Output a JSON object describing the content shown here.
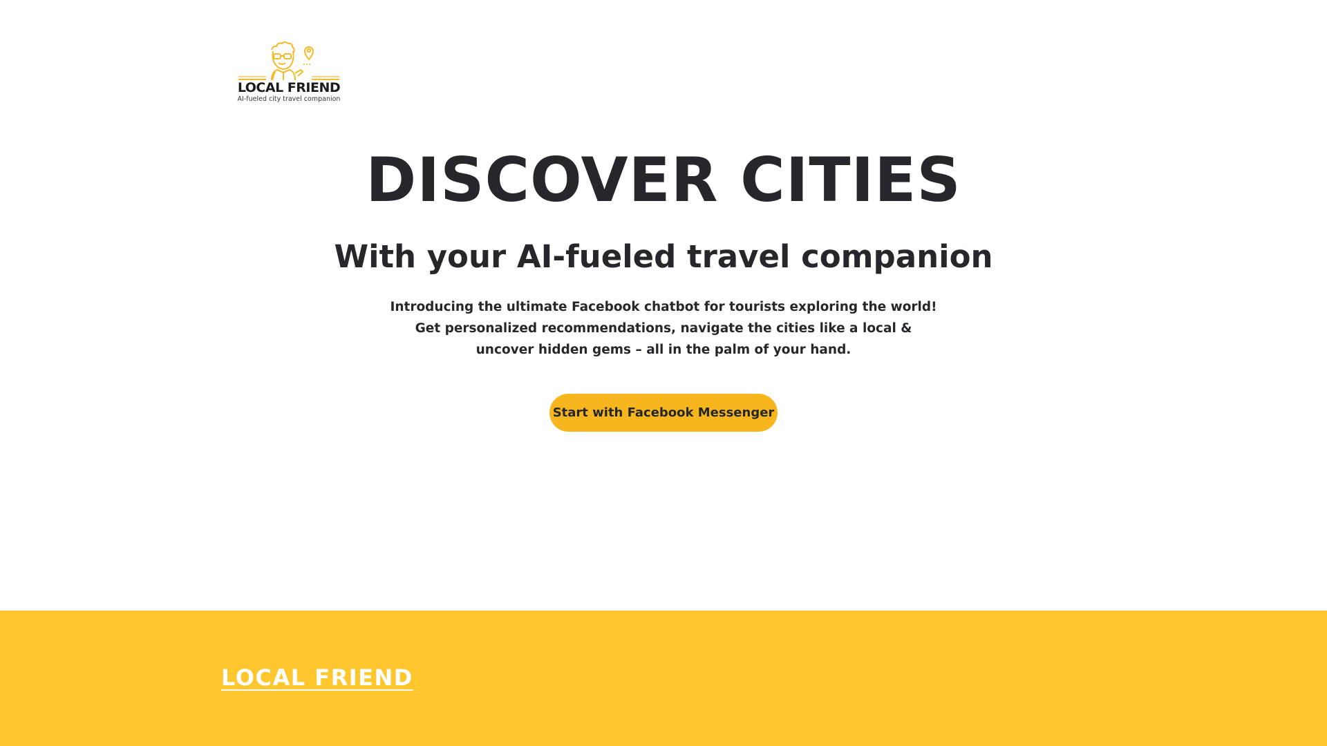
{
  "header": {
    "logo": {
      "title": "LOCAL FRIEND",
      "tagline": "AI-fueled city travel companion",
      "icon": "traveler-mascot-with-map-pin",
      "accent_color": "#f5b92a"
    }
  },
  "hero": {
    "title": "DISCOVER CITIES",
    "subtitle": "With your AI-fueled travel companion",
    "description_lines": [
      "Introducing the ultimate Facebook chatbot for tourists exploring the world!",
      "Get personalized recommendations, navigate the cities like a local &",
      "uncover hidden gems – all in the palm of your hand."
    ],
    "cta_label": "Start with Facebook Messenger",
    "cta_color": "#f7b51e"
  },
  "footer": {
    "brand_link": "LOCAL FRIEND",
    "background_color": "#fdc72d"
  }
}
